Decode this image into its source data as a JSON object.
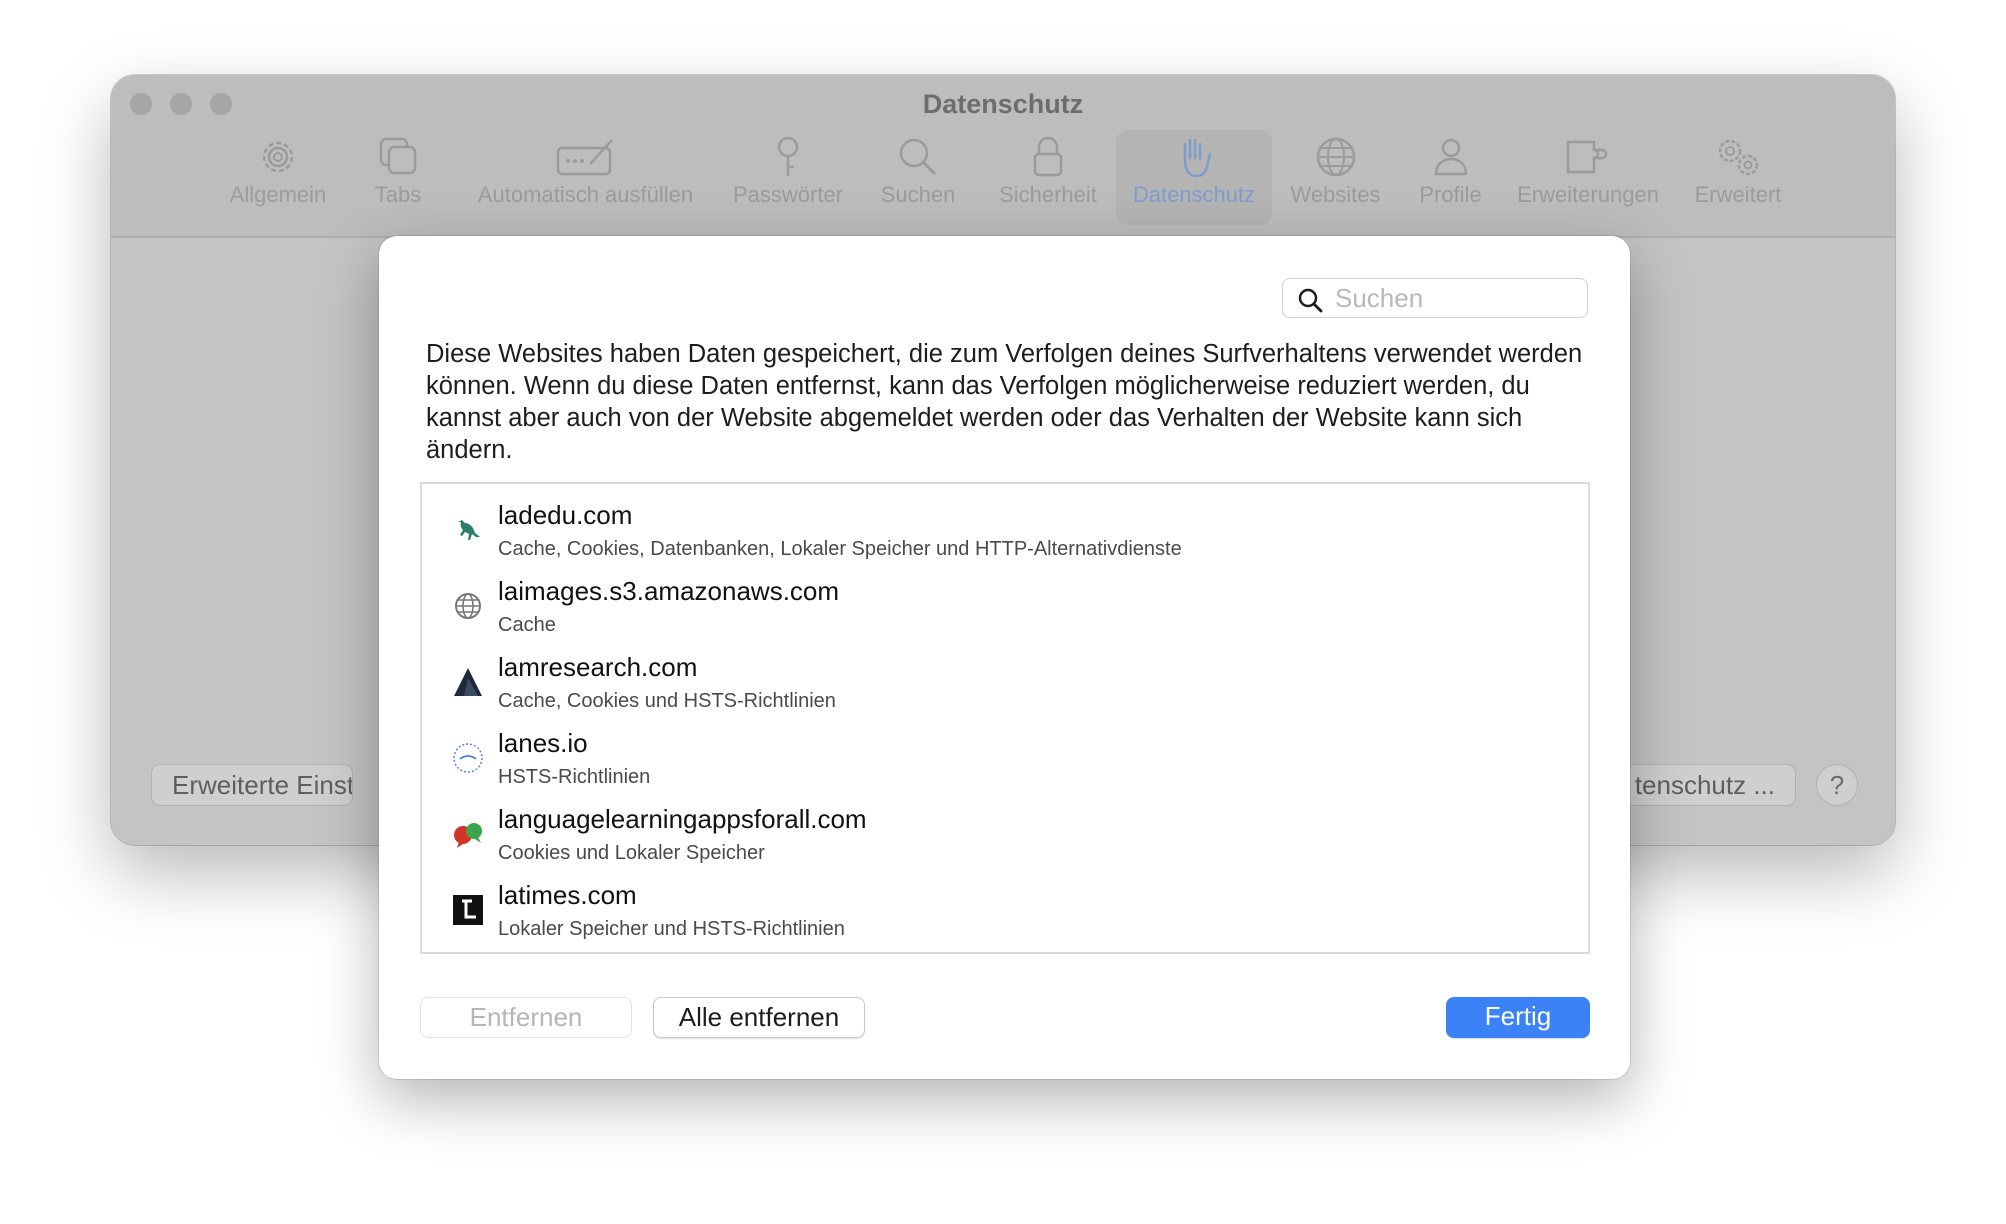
{
  "window": {
    "title": "Datenschutz",
    "toolbar": [
      {
        "label": "Allgemein",
        "icon": "gear-icon"
      },
      {
        "label": "Tabs",
        "icon": "tabs-icon"
      },
      {
        "label": "Automatisch ausfüllen",
        "icon": "autofill-icon"
      },
      {
        "label": "Passwörter",
        "icon": "key-icon"
      },
      {
        "label": "Suchen",
        "icon": "search-icon"
      },
      {
        "label": "Sicherheit",
        "icon": "lock-icon"
      },
      {
        "label": "Datenschutz",
        "icon": "hand-icon"
      },
      {
        "label": "Websites",
        "icon": "globe-icon"
      },
      {
        "label": "Profile",
        "icon": "person-icon"
      },
      {
        "label": "Erweiterungen",
        "icon": "puzzle-icon"
      },
      {
        "label": "Erweitert",
        "icon": "gears-icon"
      }
    ],
    "active_tab": "Datenschutz",
    "advanced_button_label": "Erweiterte Einste",
    "privacy_button_label": "tenschutz ...",
    "help_label": "?"
  },
  "sheet": {
    "search_placeholder": "Suchen",
    "description": "Diese Websites haben Daten gespeichert, die zum Verfolgen deines Surfverhaltens verwendet werden können. Wenn du diese Daten entfernst, kann das Verfolgen möglicherweise reduziert werden, du kannst aber auch von der Website abgemeldet werden oder das Verhalten der Website kann sich ändern.",
    "sites": [
      {
        "domain": "ladedu.com",
        "data": "Cache, Cookies, Datenbanken, Lokaler Speicher und HTTP-Alternativdienste",
        "icon": "kangaroo-icon"
      },
      {
        "domain": "laimages.s3.amazonaws.com",
        "data": "Cache",
        "icon": "globe-icon"
      },
      {
        "domain": "lamresearch.com",
        "data": "Cache, Cookies und HSTS-Richtlinien",
        "icon": "lam-logo-icon"
      },
      {
        "domain": "lanes.io",
        "data": "HSTS-Richtlinien",
        "icon": "lanes-logo-icon"
      },
      {
        "domain": "languagelearningappsforall.com",
        "data": "Cookies und Lokaler Speicher",
        "icon": "speech-bubbles-icon"
      },
      {
        "domain": "latimes.com",
        "data": "Lokaler Speicher und HSTS-Richtlinien",
        "icon": "latimes-logo-icon"
      }
    ],
    "remove_label": "Entfernen",
    "remove_all_label": "Alle entfernen",
    "done_label": "Fertig",
    "accent_color": "#3b82f6"
  }
}
